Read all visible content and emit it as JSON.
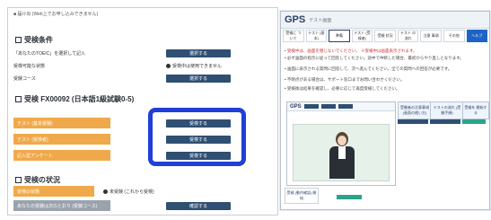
{
  "left": {
    "top_line": "■ 届け出 (Web上でお申し込みできません)",
    "section1_title": "受検条件",
    "section1_rows": [
      {
        "label": "「あなたのTOEIC」を選択して記入",
        "button": "選択する"
      },
      {
        "label": "受検可能な状態",
        "radio": "受検中は使用できません"
      },
      {
        "label": "受験コース",
        "button": "選択する"
      }
    ],
    "section2_title": "受検 FX00092 (日本語1級試験0-5)",
    "section2_rows": [
      {
        "label": "テスト (基本受験)",
        "button": "受検する"
      },
      {
        "label": "テスト (受検者)",
        "button": "受検する"
      },
      {
        "label": "記入型アンケート",
        "button": "受検する"
      }
    ],
    "section3_title": "受検の状況",
    "section3_rows": [
      {
        "label": "受検の状態",
        "radio": "未受験 (これから受検)"
      },
      {
        "label": "あなたの受験は次のとおり (受験コース)",
        "button": "確認する"
      }
    ]
  },
  "right": {
    "logo": "GPS",
    "subtitle": "テスト画面",
    "tabs": [
      {
        "label": "受検に\nついて"
      },
      {
        "label": "テスト\n(基本)"
      },
      {
        "label": "準備"
      },
      {
        "label": "テスト\n(受検者)"
      },
      {
        "label": "受験\n状況"
      },
      {
        "label": "テスト\nの流れ"
      },
      {
        "label": "注意\n事項"
      },
      {
        "label": "その他"
      },
      {
        "label": "ヘルプ"
      }
    ],
    "info_lines": [
      "• 受検中は、画面を閉じないでください。 ※受検中は画面表示されます。",
      "• 必ず画面の指示に従って回答してください。途中で中断した場合、最初からやり直しとなります。",
      "• 画面に表示される質問に回答して、次へ進んでください。全ての質問への回答が必要です。",
      "• 不明点がある場合は、サポート窓口までお問い合わせください。",
      "• 受検後は結果を確認し、必要に応じて再度受検してください。"
    ],
    "inner": {
      "logo": "GPS",
      "toolbar_labels": [
        "",
        "",
        ""
      ]
    },
    "callouts": [
      {
        "label": "受験者の注意事項\n(画面の使い方)"
      },
      {
        "label": "テストの流れ\n(受験手順)"
      },
      {
        "label": "受検を\n開始する"
      }
    ],
    "bottom_label": "受検\n(動作確認)\n開始"
  }
}
